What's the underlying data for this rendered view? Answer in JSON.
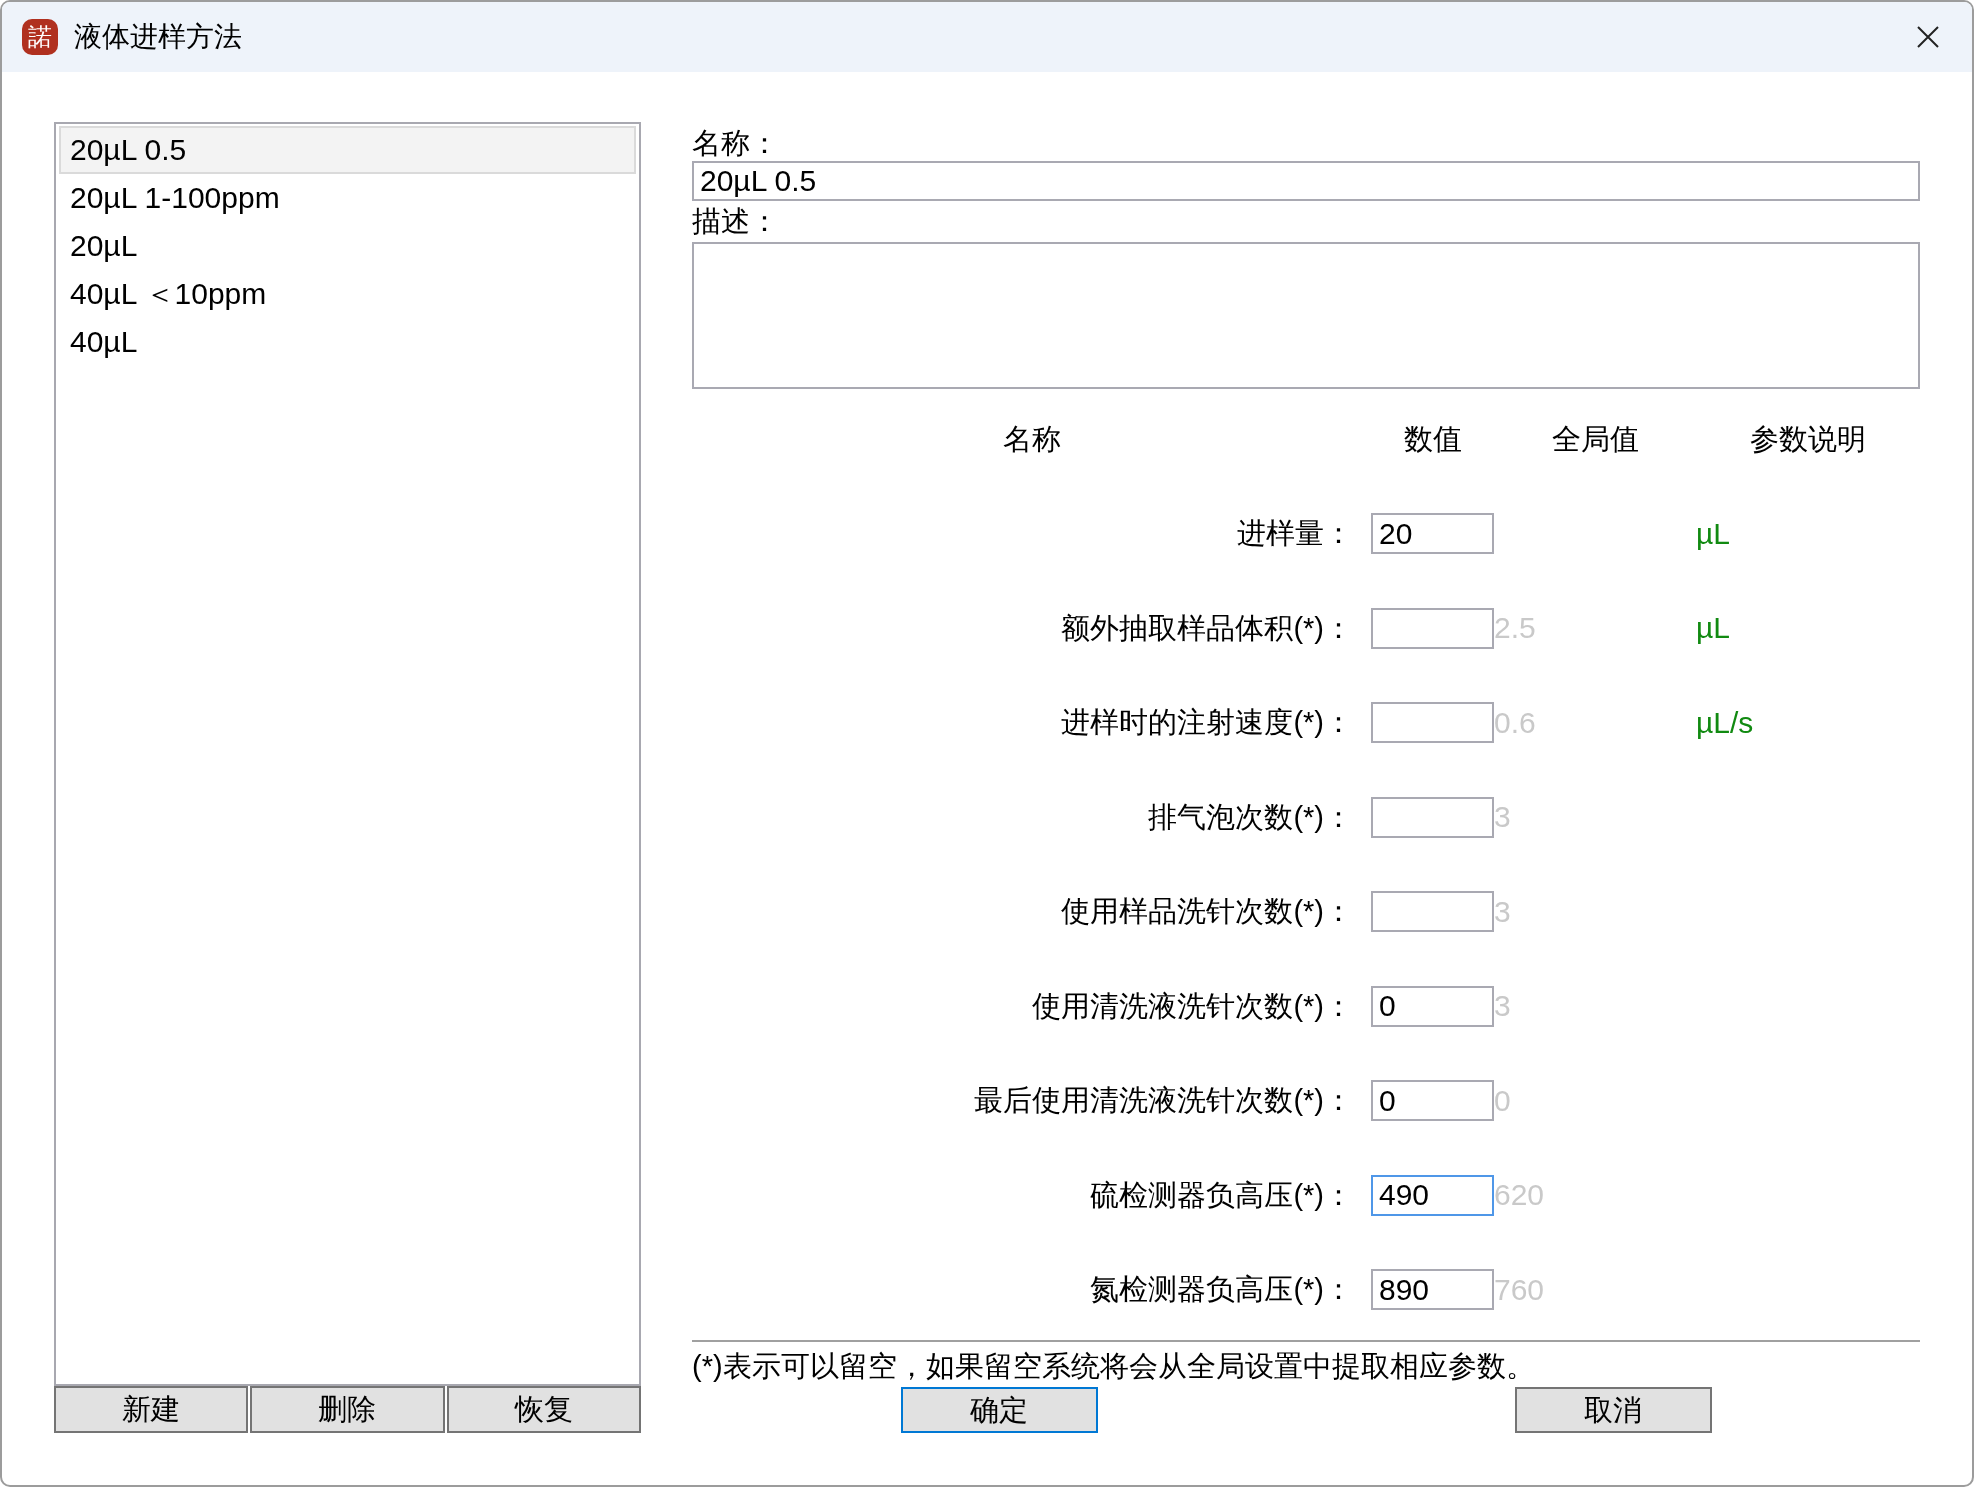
{
  "window": {
    "logo_text": "諾",
    "title": "液体进样方法"
  },
  "method_list": {
    "items": [
      {
        "label": "20µL 0.5",
        "selected": true
      },
      {
        "label": "20µL 1-100ppm",
        "selected": false
      },
      {
        "label": "20µL",
        "selected": false
      },
      {
        "label": "40µL ＜10ppm",
        "selected": false
      },
      {
        "label": "40µL",
        "selected": false
      }
    ],
    "buttons": [
      "新建",
      "删除",
      "恢复"
    ]
  },
  "form": {
    "name_label": "名称：",
    "name_value": "20µL 0.5",
    "description_label": "描述："
  },
  "parameters": {
    "columns": [
      "名称",
      "数值",
      "全局值",
      "参数说明"
    ],
    "rows": [
      {
        "label": "进样量：",
        "value": "20",
        "unit": "µL",
        "focused": false
      },
      {
        "label": "额外抽取样品体积(*)：",
        "global_value": "2.5",
        "unit": "µL",
        "focused": false
      },
      {
        "label": "进样时的注射速度(*)：",
        "global_value": "0.6",
        "unit": "µL/s",
        "focused": false
      },
      {
        "label": "排气泡次数(*)：",
        "global_value": "3",
        "focused": false
      },
      {
        "label": "使用样品洗针次数(*)：",
        "global_value": "3",
        "focused": false
      },
      {
        "label": "使用清洗液洗针次数(*)：",
        "value": "0",
        "global_value": "3",
        "focused": false
      },
      {
        "label": "最后使用清洗液洗针次数(*)：",
        "value": "0",
        "global_value": "0",
        "focused": false
      },
      {
        "label": "硫检测器负高压(*)：",
        "value": "490",
        "global_value": "620",
        "focused": true
      },
      {
        "label": "氮检测器负高压(*)：",
        "value": "890",
        "global_value": "760",
        "focused": false
      }
    ]
  },
  "note": "(*)表示可以留空，如果留空系统将会从全局设置中提取相应参数。",
  "dialog_buttons": [
    {
      "label": "确定",
      "default": true
    },
    {
      "label": "取消",
      "default": false
    }
  ]
}
